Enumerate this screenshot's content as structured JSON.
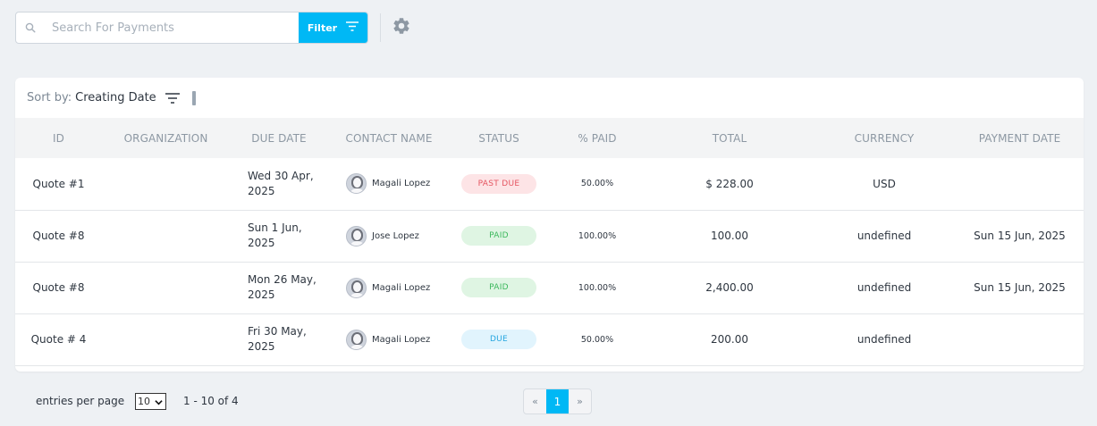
{
  "search": {
    "placeholder": "Search For Payments"
  },
  "toolbar": {
    "filter_label": "Filter"
  },
  "sort": {
    "label": "Sort by:",
    "value": "Creating Date"
  },
  "table": {
    "columns": [
      "ID",
      "ORGANIZATION",
      "DUE DATE",
      "CONTACT NAME",
      "STATUS",
      "% PAID",
      "TOTAL",
      "CURRENCY",
      "PAYMENT DATE"
    ],
    "rows": [
      {
        "id": "Quote #1",
        "organization": "",
        "due_date": "Wed 30 Apr, 2025",
        "contact": "Magali Lopez",
        "status": "PAST DUE",
        "pct_paid": "50.00%",
        "total": "$ 228.00",
        "currency": "USD",
        "payment_date": ""
      },
      {
        "id": "Quote #8",
        "organization": "",
        "due_date": "Sun 1 Jun, 2025",
        "contact": "Jose Lopez",
        "status": "PAID",
        "pct_paid": "100.00%",
        "total": "100.00",
        "currency": "undefined",
        "payment_date": "Sun 15 Jun, 2025"
      },
      {
        "id": "Quote #8",
        "organization": "",
        "due_date": "Mon 26 May, 2025",
        "contact": "Magali Lopez",
        "status": "PAID",
        "pct_paid": "100.00%",
        "total": "2,400.00",
        "currency": "undefined",
        "payment_date": "Sun 15 Jun, 2025"
      },
      {
        "id": "Quote # 4",
        "organization": "",
        "due_date": "Fri 30 May, 2025",
        "contact": "Magali Lopez",
        "status": "DUE",
        "pct_paid": "50.00%",
        "total": "200.00",
        "currency": "undefined",
        "payment_date": ""
      }
    ]
  },
  "footer": {
    "entries_label": "entries per page",
    "entries_value": "10",
    "range": "1 - 10 of 4",
    "pager": {
      "prev": "«",
      "current": "1",
      "next": "»"
    }
  },
  "colors": {
    "accent": "#00b8f5",
    "past_due": "#e55561",
    "paid": "#3bb85c",
    "due": "#26a6e0"
  }
}
